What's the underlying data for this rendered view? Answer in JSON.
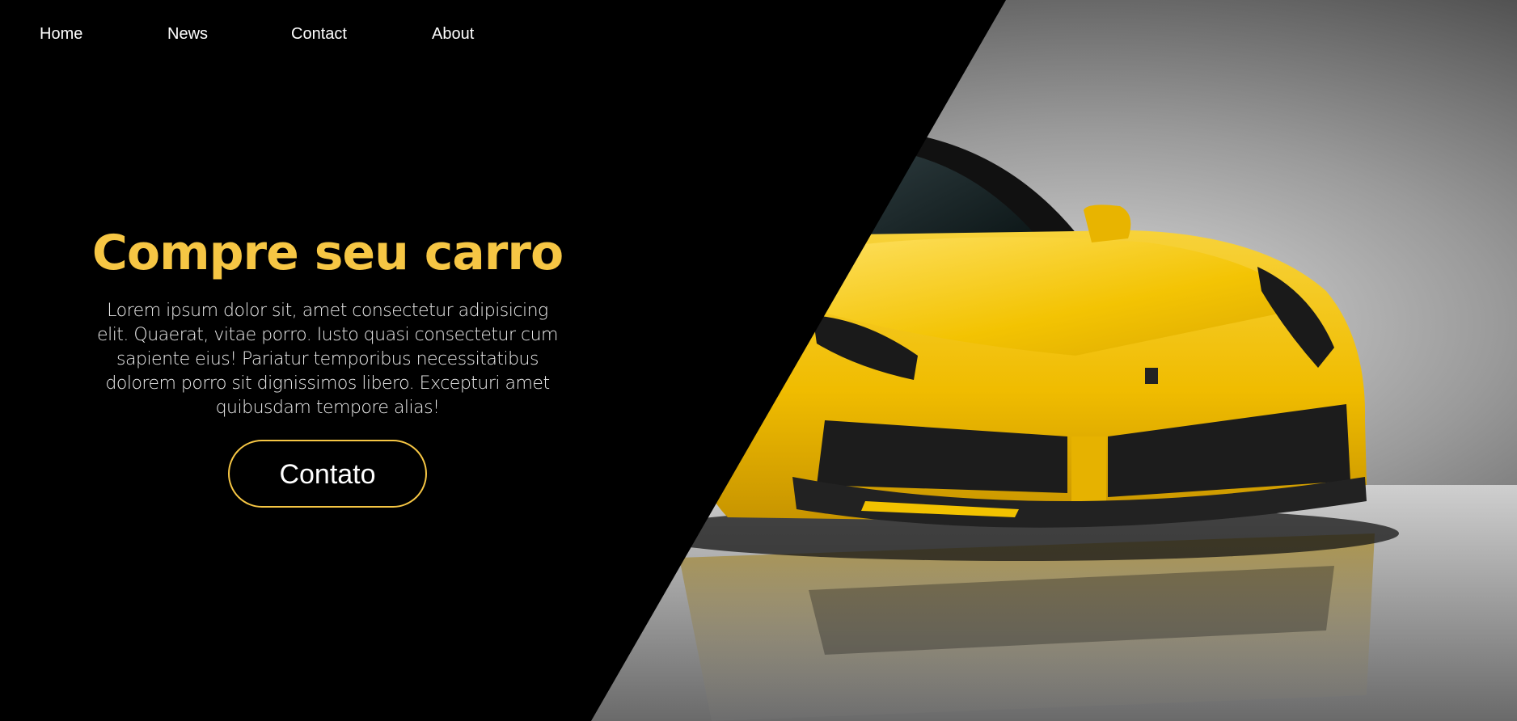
{
  "nav": {
    "items": [
      {
        "label": "Home"
      },
      {
        "label": "News"
      },
      {
        "label": "Contact"
      },
      {
        "label": "About"
      }
    ]
  },
  "hero": {
    "title": "Compre seu carro",
    "body": "Lorem ipsum dolor sit, amet consectetur adipisicing elit. Quaerat, vitae porro. Iusto quasi consectetur cum sapiente eius! Pariatur temporibus necessitatibus dolorem porro sit dignissimos libero. Excepturi amet quibusdam tempore alias!",
    "cta_label": "Contato"
  },
  "colors": {
    "accent": "#f6c644",
    "background": "#000000",
    "car_yellow": "#f2c200"
  }
}
